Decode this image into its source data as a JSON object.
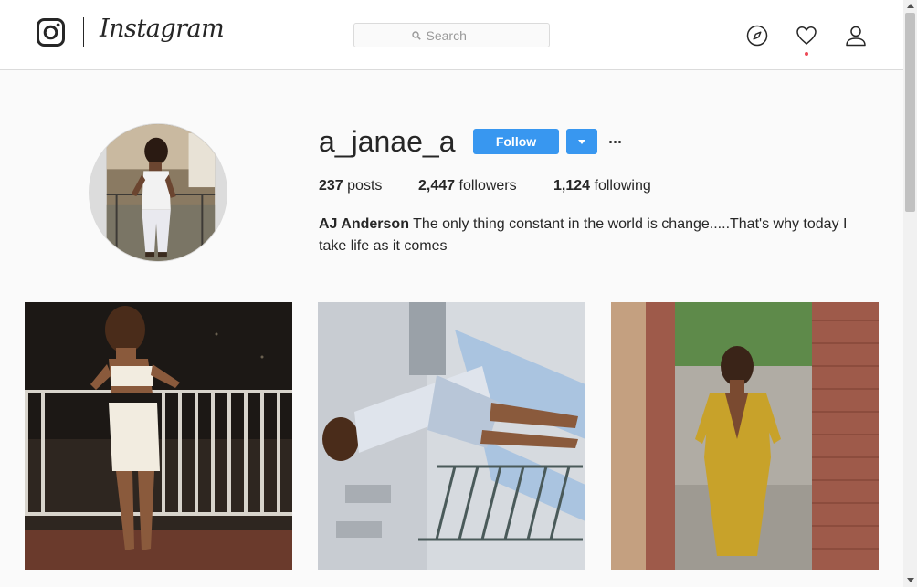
{
  "brand": {
    "wordmark": "Instagram",
    "logo_icon": "instagram-glyph-icon"
  },
  "search": {
    "placeholder": "Search",
    "icon": "search-icon"
  },
  "nav_icons": [
    "compass-icon",
    "heart-icon",
    "user-icon"
  ],
  "notification_dot": true,
  "profile": {
    "username": "a_janae_a",
    "follow_label": "Follow",
    "dropdown_icon": "caret-down-icon",
    "more_icon": "ellipsis-icon",
    "stats": {
      "posts_count": "237",
      "posts_label": "posts",
      "followers_count": "2,447",
      "followers_label": "followers",
      "following_count": "1,124",
      "following_label": "following"
    },
    "bio": {
      "full_name": "AJ Anderson",
      "text": "The only thing constant in the world is change.....That's why today I take life as it comes"
    }
  },
  "colors": {
    "primary_button": "#3897f0",
    "text": "#262626",
    "border": "#dbdbdb",
    "background": "#fafafa",
    "notification": "#ed4956"
  }
}
